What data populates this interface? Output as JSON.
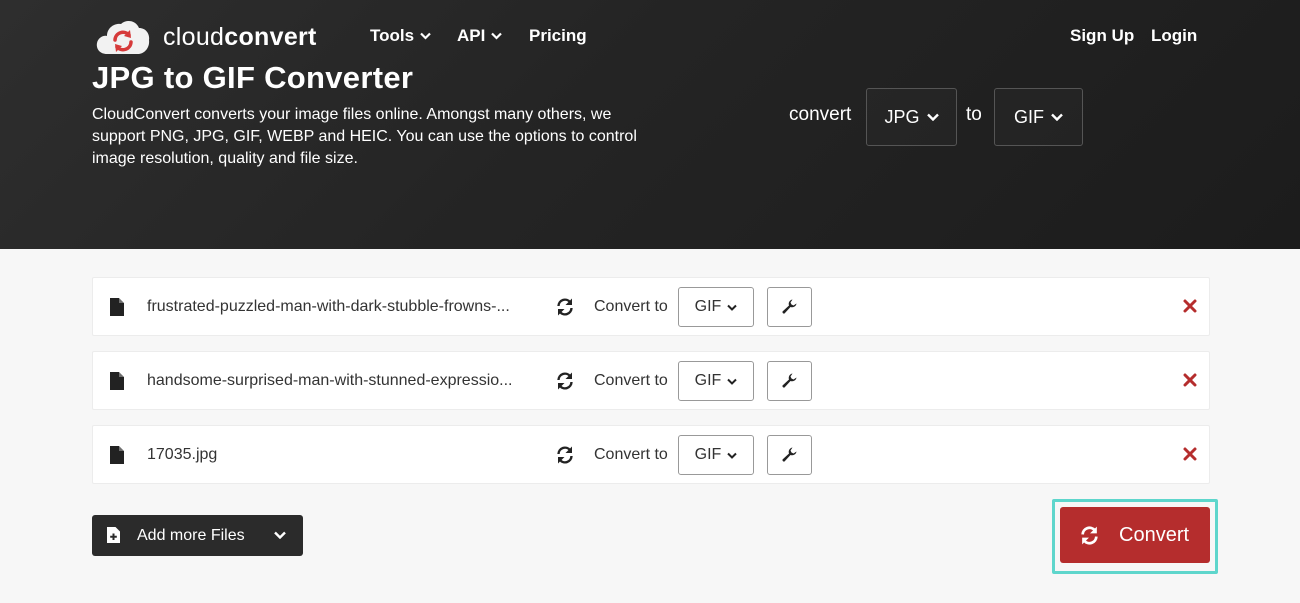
{
  "nav": {
    "logo_regular": "cloud",
    "logo_bold": "convert",
    "tools": "Tools",
    "api": "API",
    "pricing": "Pricing",
    "signup": "Sign Up",
    "login": "Login"
  },
  "hero": {
    "title": "JPG to GIF Converter",
    "description": "CloudConvert converts your image files online. Amongst many others, we support PNG, JPG, GIF, WEBP and HEIC. You can use the options to control image resolution, quality and file size.",
    "convert_word": "convert",
    "from_format": "JPG",
    "to_word": "to",
    "to_format": "GIF"
  },
  "files": [
    {
      "name": "frustrated-puzzled-man-with-dark-stubble-frowns-...",
      "convert_to_label": "Convert to",
      "format": "GIF"
    },
    {
      "name": "handsome-surprised-man-with-stunned-expressio...",
      "convert_to_label": "Convert to",
      "format": "GIF"
    },
    {
      "name": "17035.jpg",
      "convert_to_label": "Convert to",
      "format": "GIF"
    }
  ],
  "actions": {
    "add_more_files": "Add more Files",
    "convert": "Convert"
  },
  "colors": {
    "header_bg": "#262626",
    "convert_red": "#b52d2d",
    "remove_red": "#b52d2d",
    "highlight_teal": "#5ed6cc"
  }
}
